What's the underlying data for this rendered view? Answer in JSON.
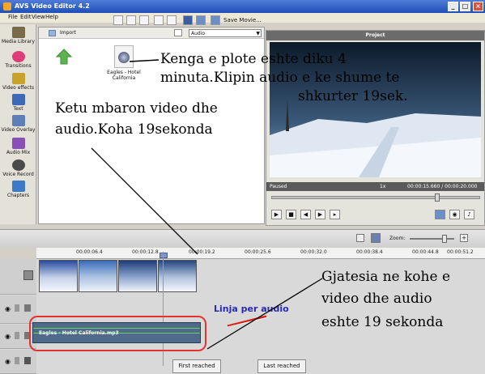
{
  "app": {
    "title": "AVS Video Editor 4.2"
  },
  "menu": [
    "File",
    "Edit",
    "View",
    "Help"
  ],
  "toolbar": {
    "save_movie": "Save Movie..."
  },
  "sidebar": {
    "items": [
      {
        "label": "Media Library"
      },
      {
        "label": "Transitions"
      },
      {
        "label": "Video effects"
      },
      {
        "label": "Text"
      },
      {
        "label": "Video Overlay"
      },
      {
        "label": "Audio Mix"
      },
      {
        "label": "Voice Record"
      },
      {
        "label": "Chapters"
      }
    ]
  },
  "media": {
    "import_label": "Import",
    "filter_value": "Audio",
    "file": {
      "label": "Eagles - Hotel California"
    }
  },
  "project": {
    "title": "Project",
    "status": "Paused",
    "speed": "1x",
    "time": "00:00:15.660 / 00:00:20.000"
  },
  "timeline": {
    "zoom_label": "Zoom:",
    "ruler": [
      "00:00:06.4",
      "00:00:12.8",
      "00:00:19.2",
      "00:00:25.6",
      "00:00:32.0",
      "00:00:38.4",
      "00:00:44.8",
      "00:00:51.2"
    ],
    "audio_clip_label": "Eagles - Hotel California.mp3",
    "audio_line_label": "Linja per audio",
    "markers": {
      "first": "First reached",
      "last": "Last reached"
    }
  },
  "annotations": {
    "song_note_1": "Kenga e plote eshte diku 4",
    "song_note_2": "minuta.Klipin audio e ke shume te",
    "song_note_3": "shkurter 19sek.",
    "end_note_1": "Ketu mbaron video dhe",
    "end_note_2": "audio.Koha 19sekonda",
    "length_note_1": "Gjatesia ne kohe e",
    "length_note_2": "video dhe audio",
    "length_note_3": "eshte 19 sekonda"
  }
}
